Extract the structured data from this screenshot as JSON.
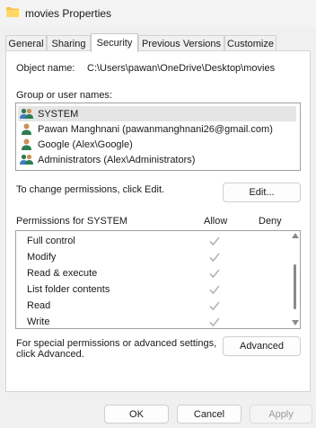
{
  "window": {
    "title": "movies Properties"
  },
  "tabs": [
    {
      "label": "General"
    },
    {
      "label": "Sharing"
    },
    {
      "label": "Security"
    },
    {
      "label": "Previous Versions"
    },
    {
      "label": "Customize"
    }
  ],
  "security": {
    "object_name_label": "Object name:",
    "object_name_value": "C:\\Users\\pawan\\OneDrive\\Desktop\\movies",
    "group_label": "Group or user names:",
    "groups": [
      {
        "name": "SYSTEM",
        "icon": "user-group-icon"
      },
      {
        "name": "Pawan Manghnani (pawanmanghnani26@gmail.com)",
        "icon": "user-icon"
      },
      {
        "name": "Google (Alex\\Google)",
        "icon": "user-icon"
      },
      {
        "name": "Administrators (Alex\\Administrators)",
        "icon": "user-group-icon"
      }
    ],
    "change_text": "To change permissions, click Edit.",
    "edit_button": "Edit...",
    "permissions_label": "Permissions for SYSTEM",
    "allow_header": "Allow",
    "deny_header": "Deny",
    "permissions": [
      {
        "name": "Full control",
        "allow": true
      },
      {
        "name": "Modify",
        "allow": true
      },
      {
        "name": "Read & execute",
        "allow": true
      },
      {
        "name": "List folder contents",
        "allow": true
      },
      {
        "name": "Read",
        "allow": true
      },
      {
        "name": "Write",
        "allow": true
      }
    ],
    "special_text_line1": "For special permissions or advanced settings,",
    "special_text_line2": "click Advanced.",
    "advanced_button": "Advanced"
  },
  "footer": {
    "ok": "OK",
    "cancel": "Cancel",
    "apply": "Apply"
  },
  "colors": {
    "check": "#b5b5b5",
    "accent": "#0067c0"
  }
}
